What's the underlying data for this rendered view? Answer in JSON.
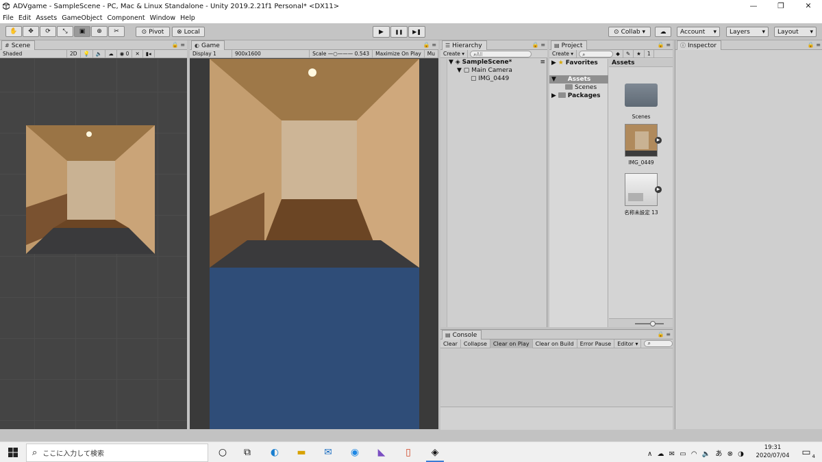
{
  "window": {
    "title": "ADVgame - SampleScene - PC, Mac & Linux Standalone - Unity 2019.2.21f1 Personal* <DX11>",
    "minimize": "—",
    "restore": "❐",
    "close": "✕"
  },
  "menu": [
    "File",
    "Edit",
    "Assets",
    "GameObject",
    "Component",
    "Window",
    "Help"
  ],
  "toolbar": {
    "tools": [
      "hand-icon",
      "move-icon",
      "rotate-icon",
      "scale-icon",
      "rect-icon",
      "transform-icon",
      "custom-icon"
    ],
    "pivot": "Pivot",
    "local": "Local",
    "play": "▶",
    "pause": "❚❚",
    "step": "▶❚",
    "collab": "Collab ▾",
    "cloud": "☁",
    "account": "Account",
    "layers": "Layers",
    "layout": "Layout"
  },
  "scene": {
    "tab": "Scene",
    "shading": "Shaded",
    "mode2d": "2D",
    "gizmo_count": "0"
  },
  "game": {
    "tab": "Game",
    "display": "Display 1",
    "resolution": "900x1600",
    "scale_label": "Scale",
    "scale_value": "0.543",
    "maximize": "Maximize On Play",
    "mute": "Mu"
  },
  "hierarchy": {
    "tab": "Hierarchy",
    "create": "Create ▾",
    "search_placeholder": "All",
    "items": [
      "SampleScene*",
      "Main Camera",
      "IMG_0449"
    ]
  },
  "project": {
    "tab": "Project",
    "create": "Create ▾",
    "tree": [
      "Favorites",
      "Assets",
      "Scenes",
      "Packages"
    ],
    "breadcrumb": "Assets",
    "assets": [
      "Scenes",
      "IMG_0449",
      "名称未設定 13"
    ],
    "count": "1"
  },
  "inspector": {
    "tab": "Inspector"
  },
  "console": {
    "tab": "Console",
    "buttons": [
      "Clear",
      "Collapse",
      "Clear on Play",
      "Clear on Build",
      "Error Pause",
      "Editor ▾"
    ]
  },
  "taskbar": {
    "search_placeholder": "ここに入力して検索",
    "time": "19:31",
    "date": "2020/07/04",
    "notifications": "4",
    "tray": "∧ ☁ ✉ ▭ ◠ 🔈 あ ⊗ ◑"
  },
  "colors": {
    "game_bg": "#2f4d78",
    "scene_bg": "#444444",
    "editor_gray": "#c2c2c2"
  }
}
